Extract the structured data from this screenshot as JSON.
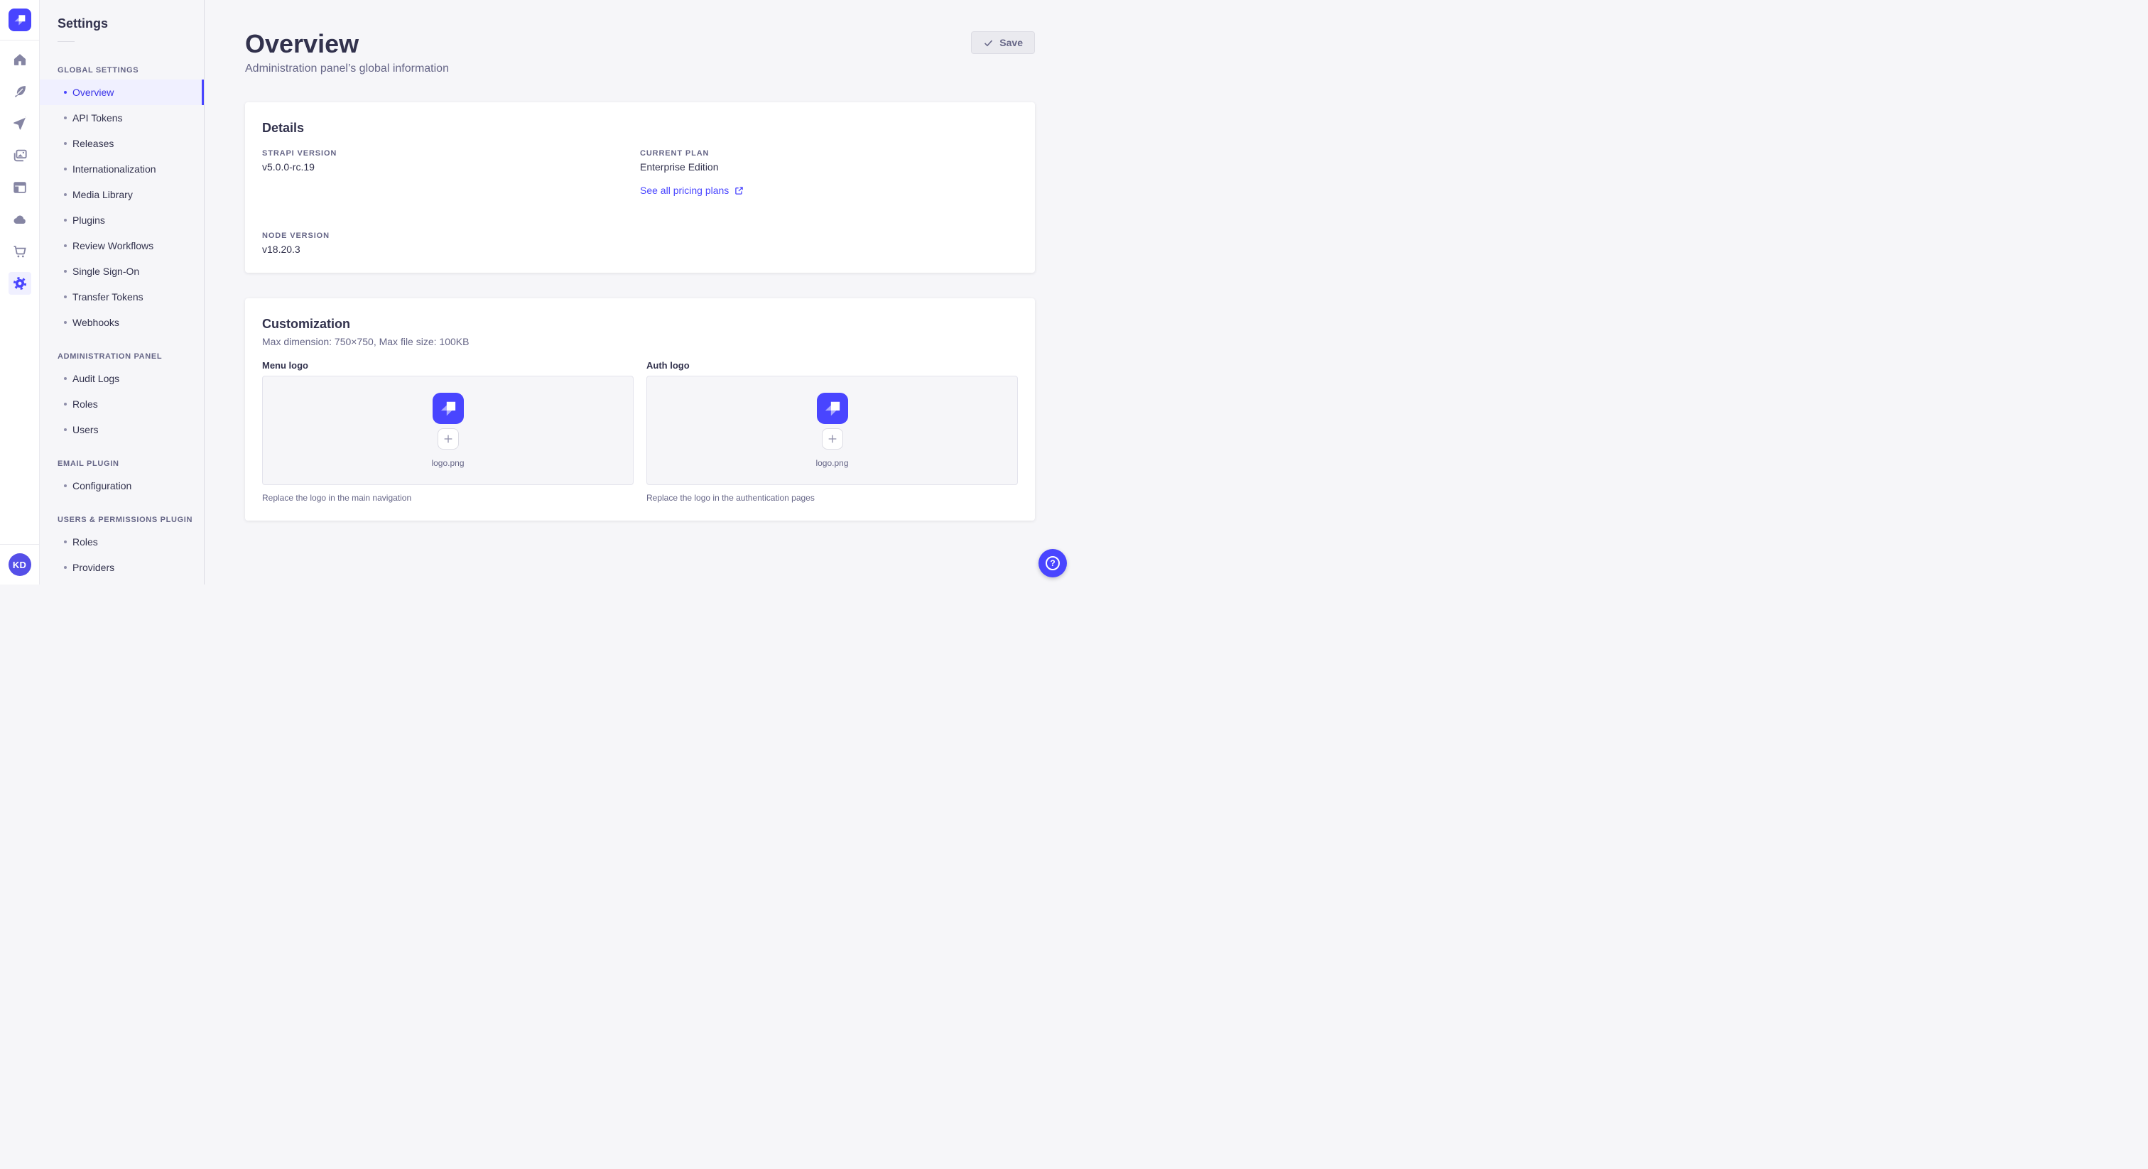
{
  "app": {
    "brand": "Strapi"
  },
  "icon_rail": {
    "icons": [
      "home-icon",
      "feather-icon",
      "paper-plane-icon",
      "media-icon",
      "layout-icon",
      "cloud-icon",
      "cart-icon",
      "gear-icon"
    ],
    "active": "gear-icon"
  },
  "sidebar": {
    "title": "Settings",
    "sections": [
      {
        "label": "GLOBAL SETTINGS",
        "items": [
          {
            "label": "Overview",
            "active": true
          },
          {
            "label": "API Tokens"
          },
          {
            "label": "Releases"
          },
          {
            "label": "Internationalization"
          },
          {
            "label": "Media Library"
          },
          {
            "label": "Plugins"
          },
          {
            "label": "Review Workflows"
          },
          {
            "label": "Single Sign-On"
          },
          {
            "label": "Transfer Tokens"
          },
          {
            "label": "Webhooks"
          }
        ]
      },
      {
        "label": "ADMINISTRATION PANEL",
        "items": [
          {
            "label": "Audit Logs"
          },
          {
            "label": "Roles"
          },
          {
            "label": "Users"
          }
        ]
      },
      {
        "label": "EMAIL PLUGIN",
        "items": [
          {
            "label": "Configuration"
          }
        ]
      },
      {
        "label": "USERS & PERMISSIONS PLUGIN",
        "items": [
          {
            "label": "Roles"
          },
          {
            "label": "Providers"
          }
        ]
      }
    ]
  },
  "header": {
    "title": "Overview",
    "subtitle": "Administration panel’s global information",
    "save": {
      "label": "Save",
      "icon": "check-icon"
    }
  },
  "details": {
    "title": "Details",
    "strapi_version": {
      "label": "STRAPI VERSION",
      "value": "v5.0.0-rc.19"
    },
    "current_plan": {
      "label": "CURRENT PLAN",
      "value": "Enterprise Edition"
    },
    "node_version": {
      "label": "NODE VERSION",
      "value": "v18.20.3"
    },
    "pricing_link": {
      "label": "See all pricing plans",
      "icon": "external-link-icon"
    }
  },
  "customization": {
    "title": "Customization",
    "subtitle": "Max dimension: 750×750, Max file size: 100KB",
    "menu_logo": {
      "label": "Menu logo",
      "filename": "logo.png",
      "hint": "Replace the logo in the main navigation"
    },
    "auth_logo": {
      "label": "Auth logo",
      "filename": "logo.png",
      "hint": "Replace the logo in the authentication pages"
    }
  },
  "user": {
    "initials": "KD"
  },
  "help": {
    "icon": "question-icon"
  },
  "colors": {
    "accent": "#4945ff",
    "active_text": "#3a33e8",
    "active_bg": "#f0f0ff",
    "page_bg": "#f6f6f9",
    "card_bg": "#ffffff",
    "text": "#32324d",
    "muted": "#666687",
    "border": "#eaeaef",
    "link": "#4945ff"
  }
}
